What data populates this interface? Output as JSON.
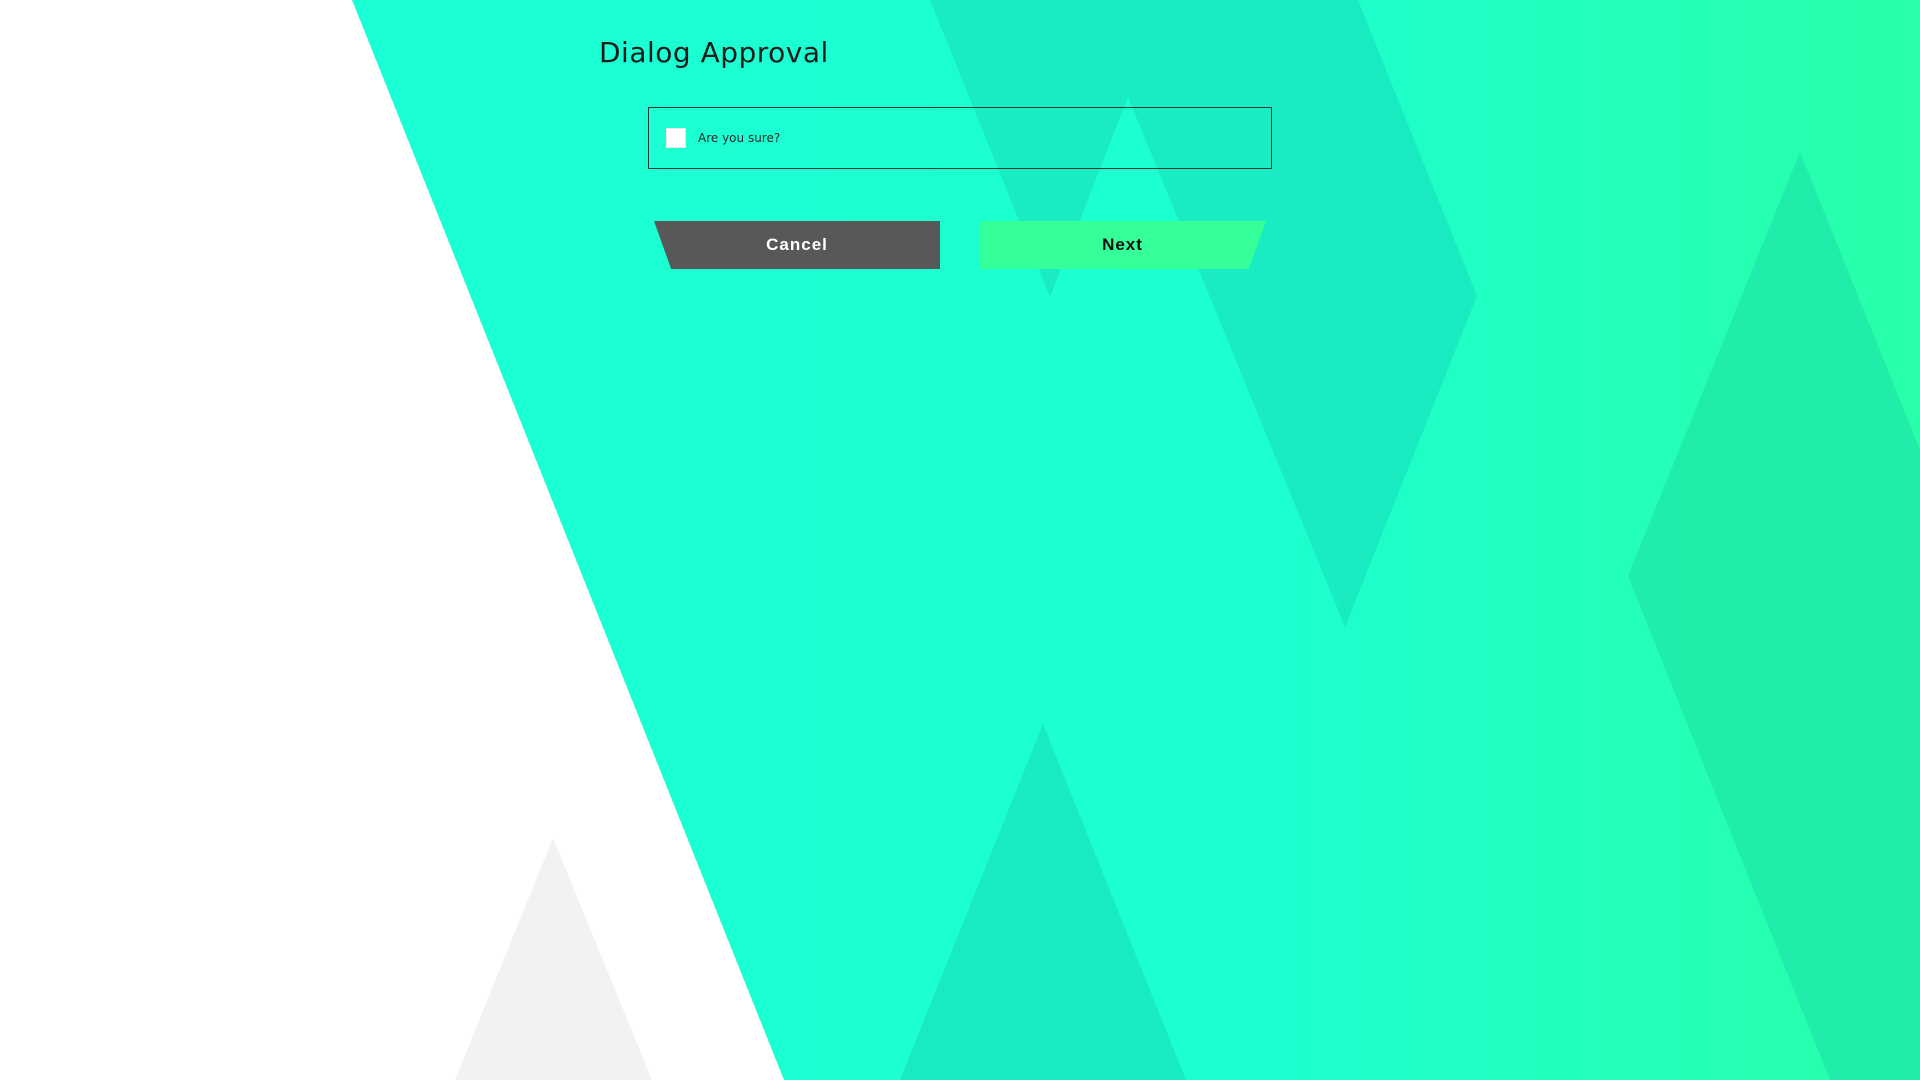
{
  "dialog": {
    "title": "Dialog Approval"
  },
  "confirmation": {
    "label": "Are you sure?",
    "checked": false
  },
  "actions": {
    "cancel_label": "Cancel",
    "next_label": "Next"
  },
  "colors": {
    "background": "#ffffff",
    "accent": "#1affd5",
    "accent_dark": "#19e8bf",
    "cancel_button": "#585858",
    "next_button": "#35ff99",
    "title_text": "#1c1c1c"
  }
}
